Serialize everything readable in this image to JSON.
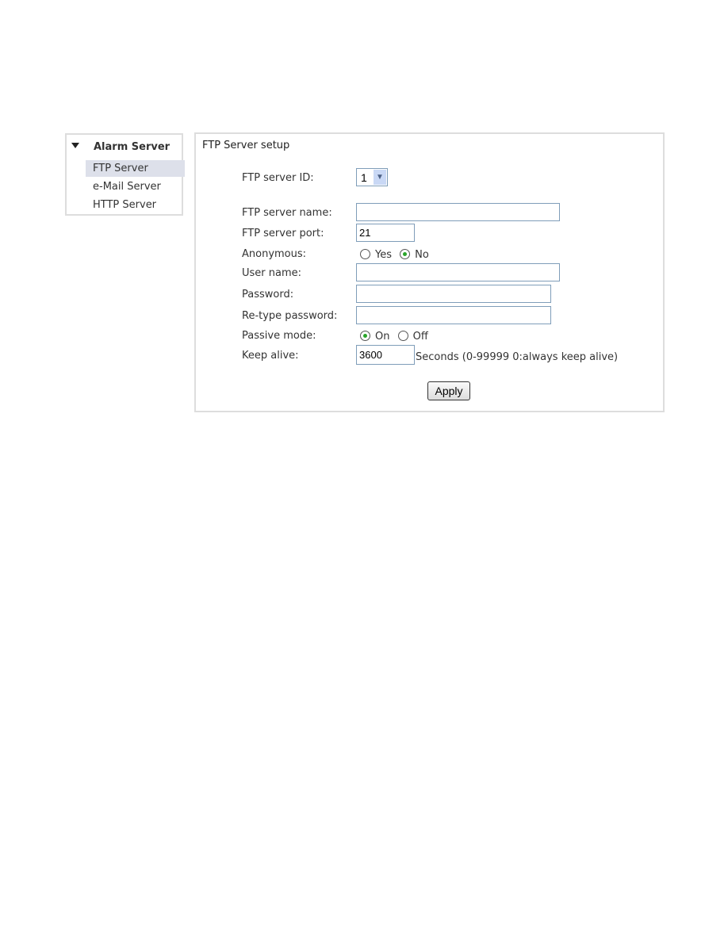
{
  "sidebar": {
    "header": "Alarm Server",
    "items": [
      {
        "label": "FTP Server",
        "selected": true
      },
      {
        "label": "e-Mail Server"
      },
      {
        "label": "HTTP Server"
      }
    ]
  },
  "panel": {
    "title": "FTP Server setup",
    "server_id": {
      "label": "FTP server ID:",
      "value": "1"
    },
    "server_name": {
      "label": "FTP server name:",
      "value": ""
    },
    "server_port": {
      "label": "FTP server port:",
      "value": "21"
    },
    "anonymous": {
      "label": "Anonymous:",
      "options": [
        "Yes",
        "No"
      ],
      "selected": "No"
    },
    "user_name": {
      "label": "User name:",
      "value": ""
    },
    "password": {
      "label": "Password:",
      "value": ""
    },
    "retype_password": {
      "label": "Re-type password:",
      "value": ""
    },
    "passive_mode": {
      "label": "Passive mode:",
      "options": [
        "On",
        "Off"
      ],
      "selected": "On"
    },
    "keep_alive": {
      "label": "Keep alive:",
      "value": "3600",
      "hint": "Seconds (0-99999 0:always keep alive)"
    },
    "apply_label": "Apply"
  },
  "colors": {
    "selected_bg": "#dde0ea",
    "radio_checked": "#2aa52a",
    "input_border": "#7f9db9"
  }
}
